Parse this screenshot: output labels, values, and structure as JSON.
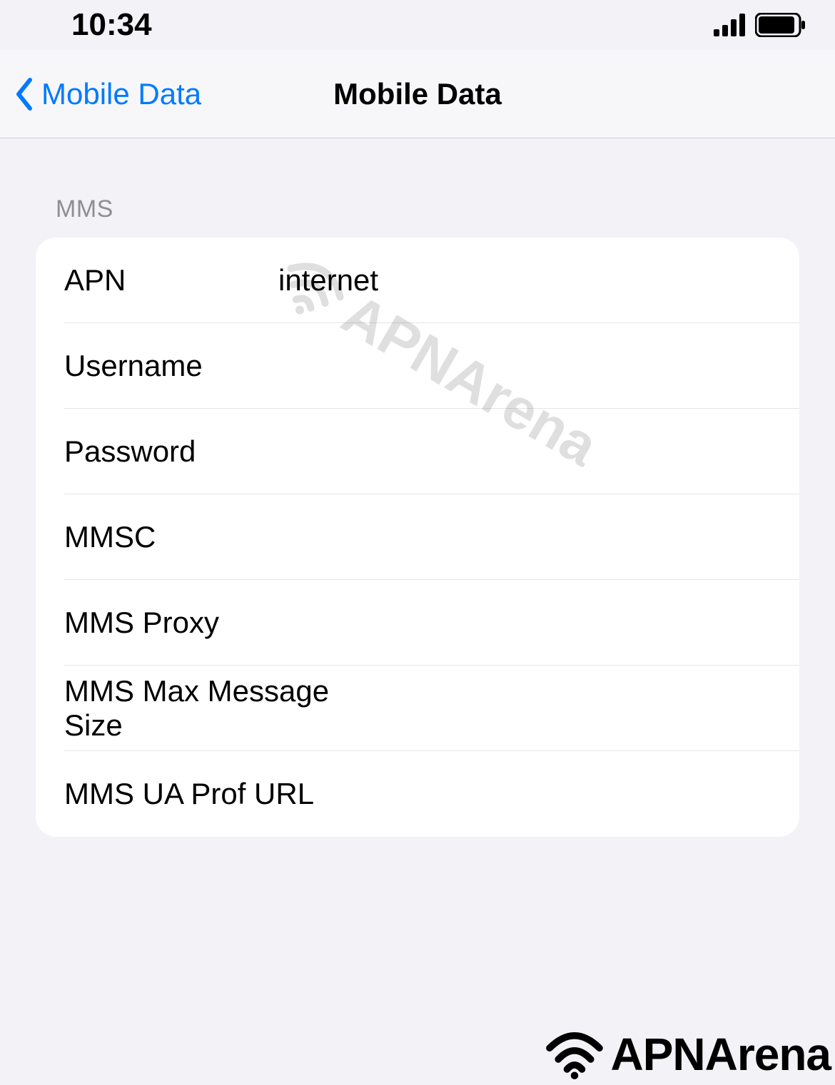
{
  "status_bar": {
    "time": "10:34"
  },
  "nav": {
    "back_label": "Mobile Data",
    "title": "Mobile Data"
  },
  "section": {
    "header": "MMS",
    "rows": [
      {
        "label": "APN",
        "value": "internet"
      },
      {
        "label": "Username",
        "value": ""
      },
      {
        "label": "Password",
        "value": ""
      },
      {
        "label": "MMSC",
        "value": ""
      },
      {
        "label": "MMS Proxy",
        "value": ""
      },
      {
        "label": "MMS Max Message Size",
        "value": ""
      },
      {
        "label": "MMS UA Prof URL",
        "value": ""
      }
    ]
  },
  "watermark": {
    "brand": "APNArena"
  }
}
